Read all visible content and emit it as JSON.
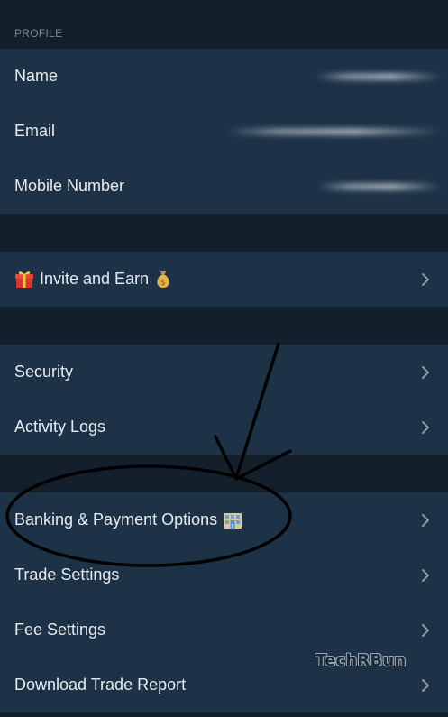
{
  "profile": {
    "section_label": "PROFILE",
    "name_label": "Name",
    "email_label": "Email",
    "mobile_label": "Mobile Number"
  },
  "referral": {
    "invite_label": "Invite and Earn"
  },
  "account": {
    "security_label": "Security",
    "activity_logs_label": "Activity Logs"
  },
  "settings": {
    "banking_label": "Banking & Payment Options",
    "trade_settings_label": "Trade Settings",
    "fee_settings_label": "Fee Settings",
    "download_report_label": "Download Trade Report"
  },
  "watermark": "TechRBun",
  "icons": {
    "chevron": "chevron-right-icon",
    "gift": "gift-icon",
    "money_bag": "money-bag-icon",
    "bank": "bank-icon"
  },
  "colors": {
    "background": "#13202c",
    "row_background": "#1d3247",
    "text": "#e6ebef",
    "muted": "#7f8b96",
    "chevron": "#8e9aa5"
  }
}
